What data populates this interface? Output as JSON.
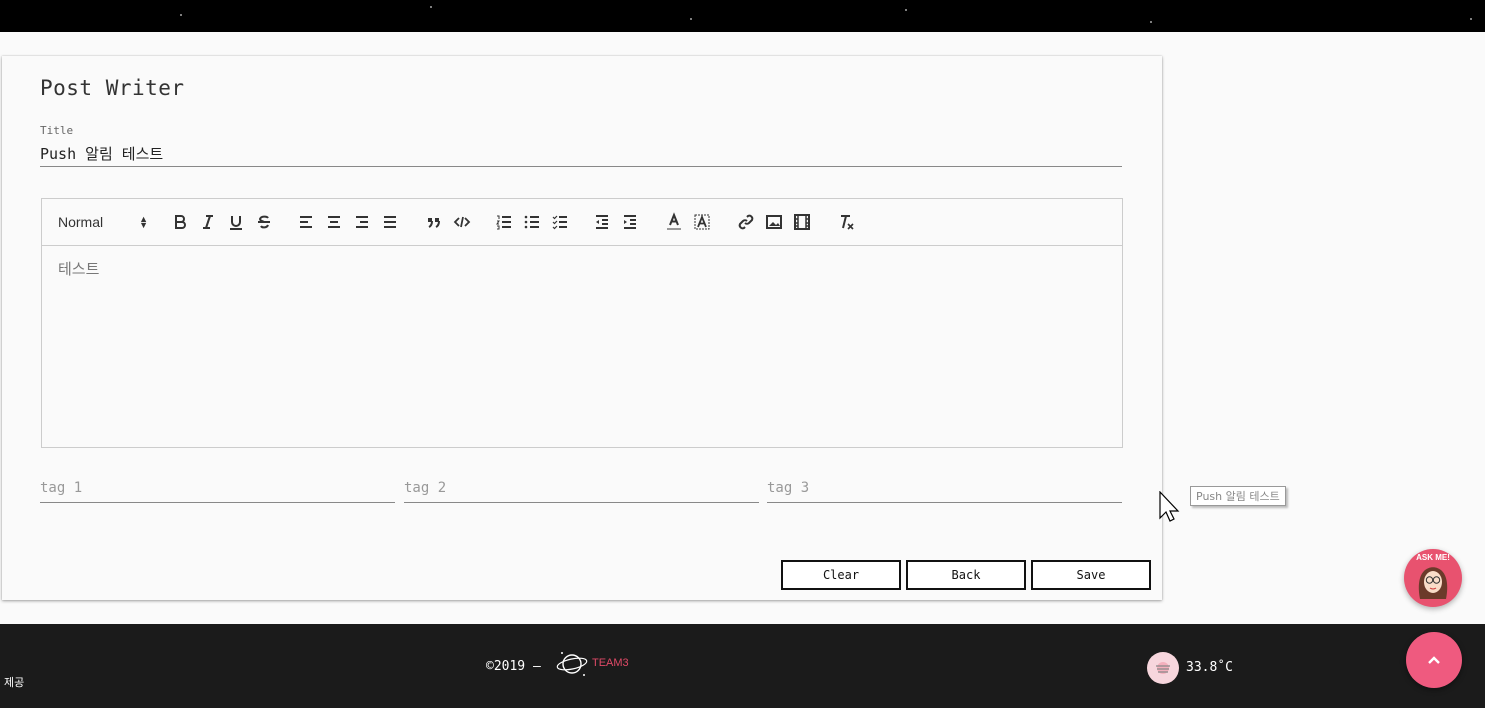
{
  "page": {
    "title": "Post Writer"
  },
  "form": {
    "title_label": "Title",
    "title_value": "Push 알림 테스트",
    "editor_text": "테스트",
    "tag1_placeholder": "tag 1",
    "tag2_placeholder": "tag 2",
    "tag3_placeholder": "tag 3"
  },
  "toolbar": {
    "header_select": "Normal",
    "icons": [
      "bold-icon",
      "italic-icon",
      "underline-icon",
      "strike-icon",
      "align-left-icon",
      "align-center-icon",
      "align-right-icon",
      "align-justify-icon",
      "blockquote-icon",
      "code-block-icon",
      "ordered-list-icon",
      "bullet-list-icon",
      "check-list-icon",
      "outdent-icon",
      "indent-icon",
      "text-color-icon",
      "background-color-icon",
      "link-icon",
      "image-icon",
      "video-icon",
      "clean-format-icon"
    ]
  },
  "buttons": {
    "clear": "Clear",
    "back": "Back",
    "save": "Save"
  },
  "tooltip": "Push 알림 테스트",
  "ask_me": "ASK ME!",
  "footer": {
    "side_text": "제공",
    "copyright": "©2019 —",
    "logo_text": "TEAM3",
    "temperature": "33.8˚C"
  },
  "colors": {
    "accent": "#ef5a7f",
    "footer_bg": "#1b1b1b",
    "header_bg": "#000000"
  }
}
